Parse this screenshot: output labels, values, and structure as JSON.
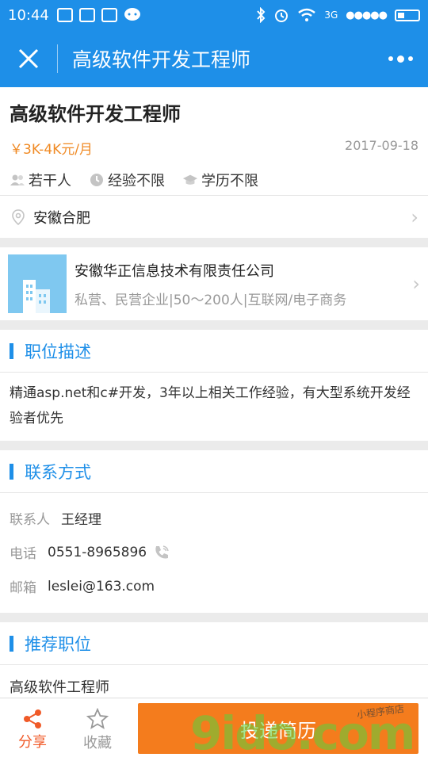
{
  "status_bar": {
    "time": "10:44",
    "network": "3G",
    "signal": "●●●●●"
  },
  "header": {
    "title": "高级软件开发工程师",
    "close_icon": "close-icon",
    "more_icon": "more-dots-icon"
  },
  "job": {
    "title": "高级软件开发工程师",
    "salary": "￥3K-4K元/月",
    "date": "2017-09-18",
    "tags": [
      {
        "icon": "people-icon",
        "label": "若干人"
      },
      {
        "icon": "clock-icon",
        "label": "经验不限"
      },
      {
        "icon": "graduation-cap-icon",
        "label": "学历不限"
      }
    ],
    "location": "安徽合肥"
  },
  "company": {
    "name": "安徽华正信息技术有限责任公司",
    "meta": "私营、民营企业|50～200人|互联网/电子商务"
  },
  "description": {
    "title": "职位描述",
    "text": "精通asp.net和c#开发，3年以上相关工作经验，有大型系统开发经验者优先"
  },
  "contact": {
    "title": "联系方式",
    "rows": [
      {
        "label": "联系人",
        "value": "王经理"
      },
      {
        "label": "电话",
        "value": "0551-8965896"
      },
      {
        "label": "邮箱",
        "value": "leslei@163.com"
      }
    ]
  },
  "recommended": {
    "title": "推荐职位",
    "items": [
      "高级软件工程师"
    ]
  },
  "bottom_bar": {
    "share_label": "分享",
    "favorite_label": "收藏",
    "apply_label": "投递简历"
  },
  "watermark": {
    "text": "9ido.com",
    "small_text": "小程序商店"
  },
  "colors": {
    "primary": "#1e8fe8",
    "accent": "#f47c1d",
    "share": "#f05a28"
  }
}
